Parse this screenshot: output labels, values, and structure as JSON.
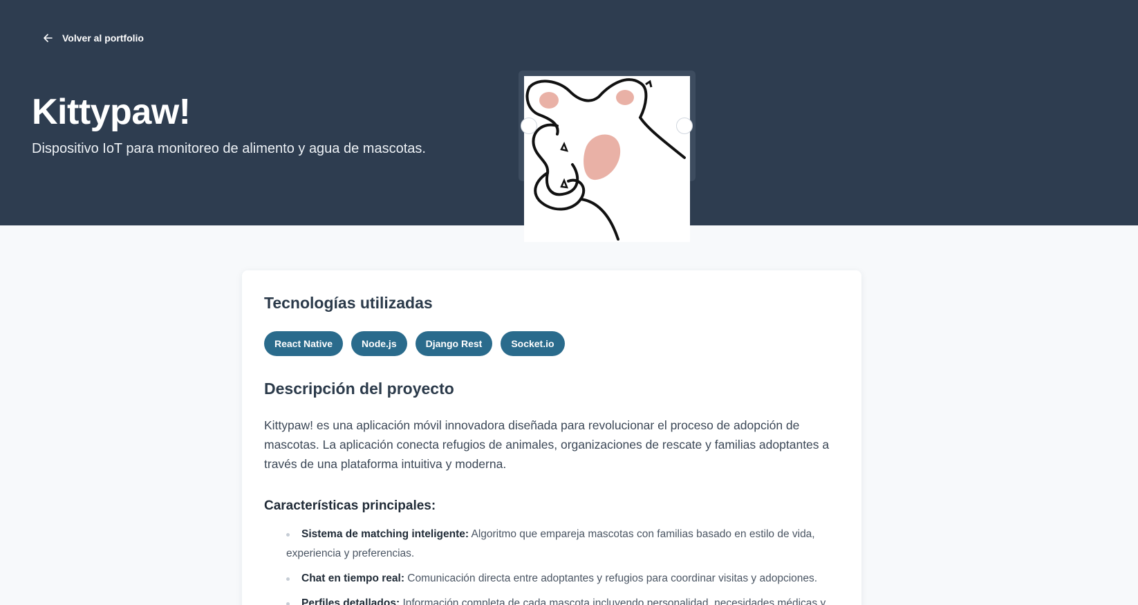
{
  "nav": {
    "back_label": "Volver al portfolio",
    "back_icon": "arrow-left-icon"
  },
  "project": {
    "title": "Kittypaw!",
    "subtitle": "Dispositivo IoT para monitoreo de alimento y agua de mascotas."
  },
  "carousel": {
    "image": "cat-paw-illustration",
    "colors": {
      "pad": "#e9b1a6",
      "outline": "#111111"
    }
  },
  "technologies": {
    "heading": "Tecnologías utilizadas",
    "items": [
      "React Native",
      "Node.js",
      "Django Rest",
      "Socket.io"
    ]
  },
  "description": {
    "heading": "Descripción del proyecto",
    "text": "Kittypaw! es una aplicación móvil innovadora diseñada para revolucionar el proceso de adopción de mascotas. La aplicación conecta refugios de animales, organizaciones de rescate y familias adoptantes a través de una plataforma intuitiva y moderna."
  },
  "features": {
    "heading": "Características principales:",
    "items": [
      {
        "name": "Sistema de matching inteligente:",
        "line1": " Algoritmo que empareja mascotas con familias basado en estilo de vida,",
        "line2": "experiencia y preferencias."
      },
      {
        "name": "Chat en tiempo real:",
        "line1": " Comunicación directa entre adoptantes y refugios para coordinar visitas y adopciones.",
        "line2": ""
      },
      {
        "name": "Perfiles detallados:",
        "line1": " Información completa de cada mascota incluyendo personalidad, necesidades médicas y",
        "line2": ""
      }
    ]
  },
  "colors": {
    "hero_bg": "#2e3d50",
    "chip_bg": "#2a6b8c",
    "page_bg": "#f7f9fb"
  }
}
